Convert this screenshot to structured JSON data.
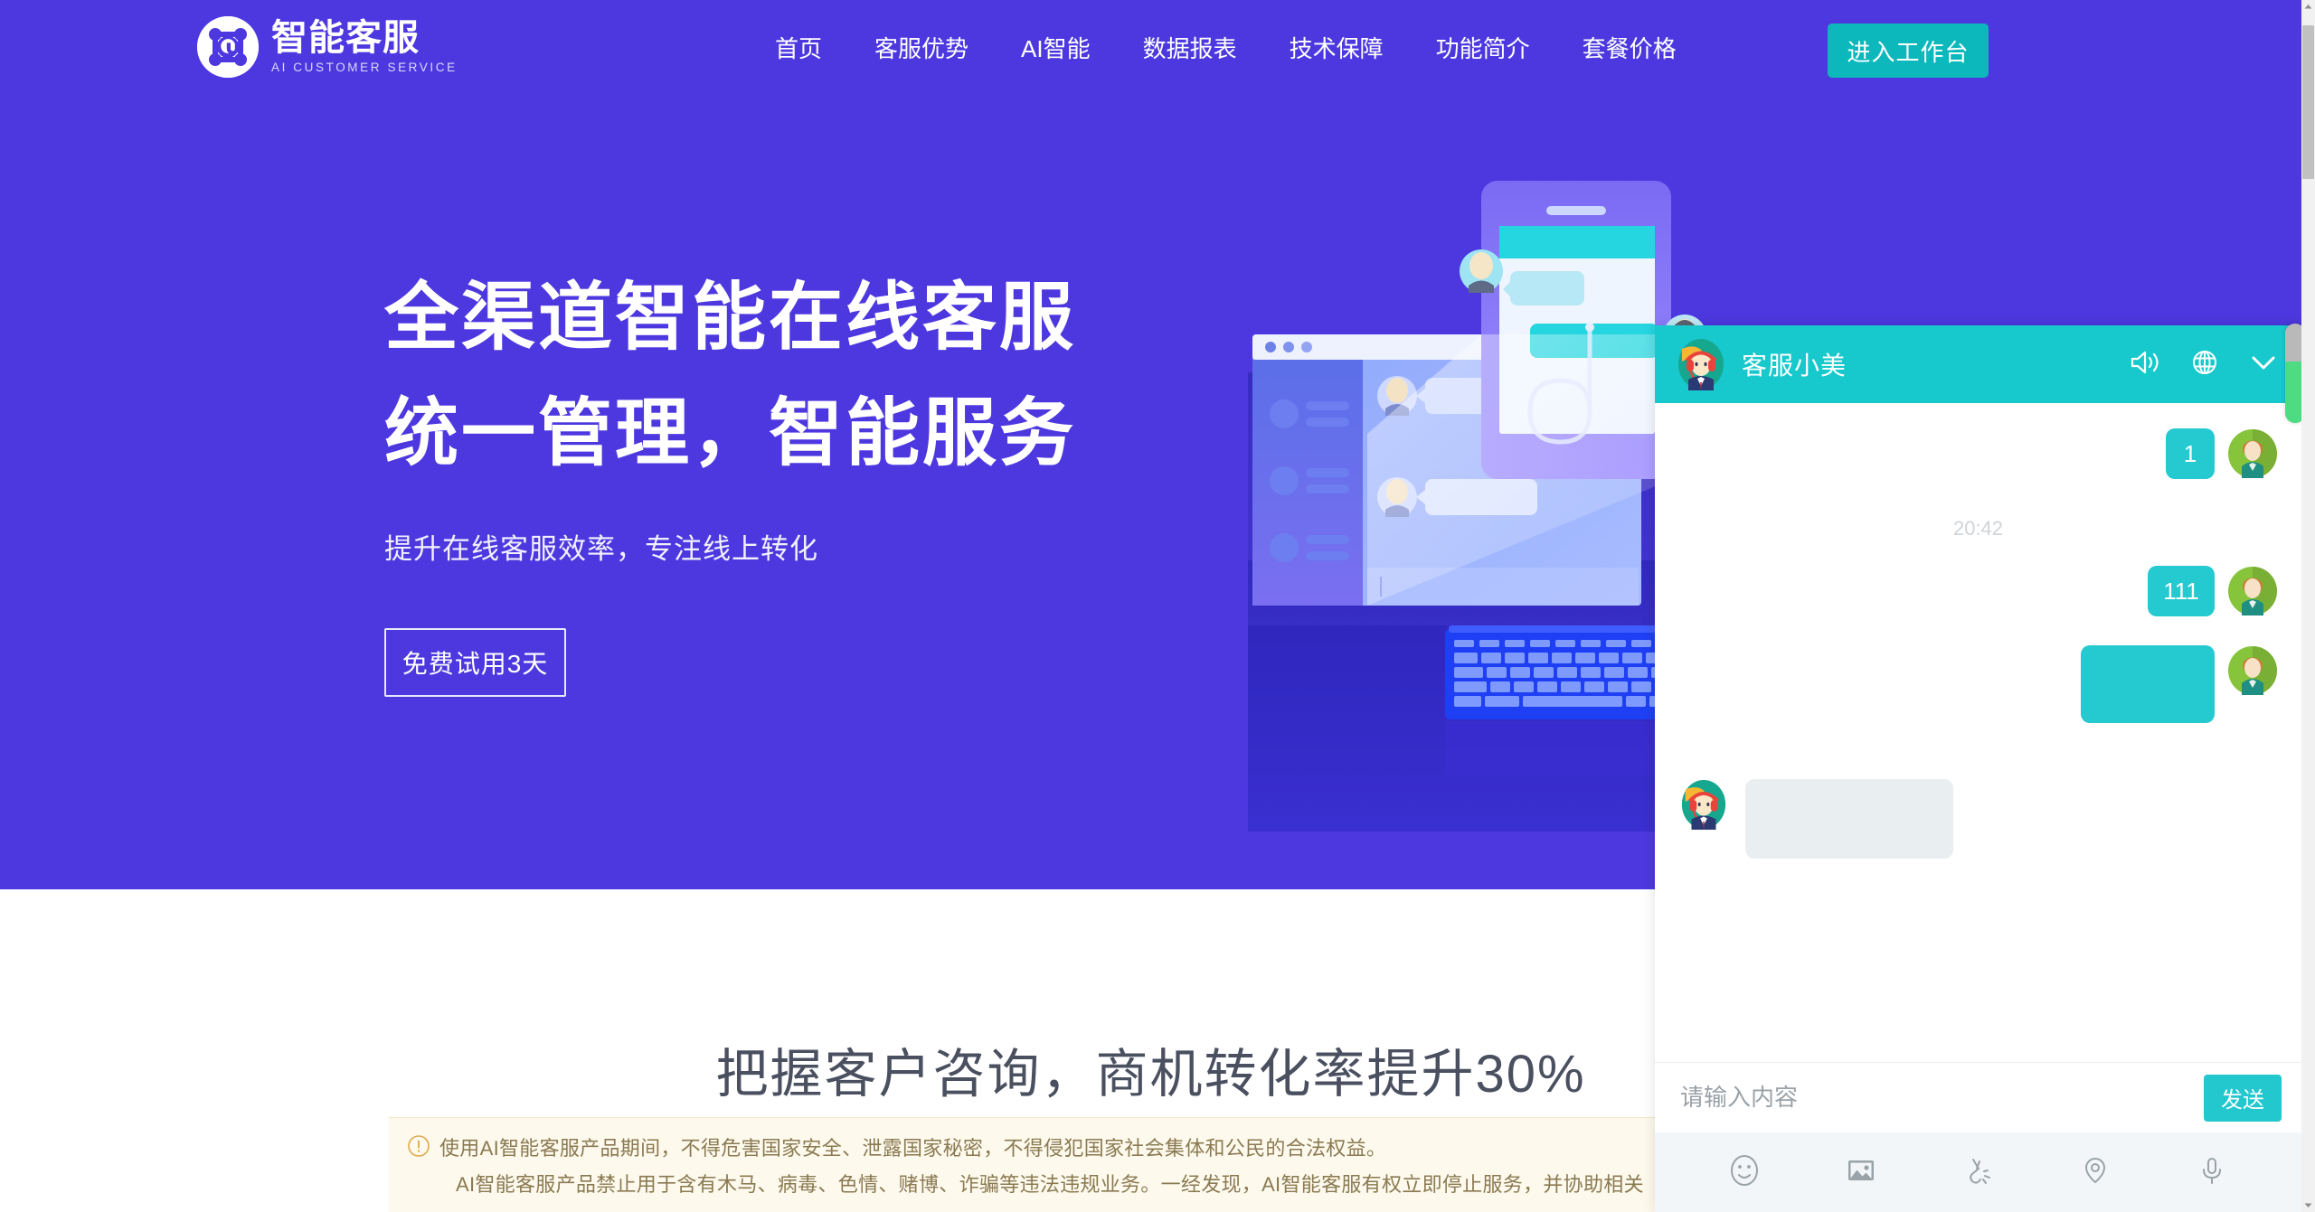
{
  "brand": {
    "logo_icon": "at-network-icon",
    "title": "智能客服",
    "subtitle": "AI CUSTOMER SERVICE",
    "primary_color": "#4d38e0",
    "accent_color": "#0cb8bc"
  },
  "nav": {
    "items": [
      {
        "label": "首页"
      },
      {
        "label": "客服优势"
      },
      {
        "label": "AI智能"
      },
      {
        "label": "数据报表"
      },
      {
        "label": "技术保障"
      },
      {
        "label": "功能简介"
      },
      {
        "label": "套餐价格"
      }
    ],
    "cta_label": "进入工作台"
  },
  "hero": {
    "headline_line1": "全渠道智能在线客服",
    "headline_line2": "统一管理，智能服务",
    "subhead": "提升在线客服效率，专注线上转化",
    "trial_label": "免费试用3天"
  },
  "section2": {
    "title": "把握客户咨询，商机转化率提升30%"
  },
  "notice": {
    "icon": "warning-circle-icon",
    "line1": "使用AI智能客服产品期间，不得危害国家安全、泄露国家秘密，不得侵犯国家社会集体和公民的合法权益。",
    "line2": "AI智能客服产品禁止用于含有木马、病毒、色情、赌博、诈骗等违法违规业务。一经发现，AI智能客服有权立即停止服务，并协助相关"
  },
  "chat": {
    "header": {
      "title": "客服小美",
      "avatar": "agent-avatar-headset",
      "icons": [
        {
          "name": "volume-icon"
        },
        {
          "name": "globe-icon"
        },
        {
          "name": "chevron-down-icon"
        }
      ]
    },
    "messages": [
      {
        "type": "user",
        "text": "1"
      },
      {
        "type": "time",
        "text": "20:42"
      },
      {
        "type": "user",
        "text": "111"
      },
      {
        "type": "user",
        "text": ""
      },
      {
        "type": "agent",
        "text": ""
      }
    ],
    "input": {
      "value": "",
      "placeholder": "请输入内容",
      "send_label": "发送"
    },
    "toolbar": [
      {
        "name": "emoji-icon"
      },
      {
        "name": "image-icon"
      },
      {
        "name": "shortcut-icon"
      },
      {
        "name": "location-icon"
      },
      {
        "name": "microphone-icon"
      }
    ]
  },
  "scroll": {
    "indicator_color": "#4ddc82"
  }
}
